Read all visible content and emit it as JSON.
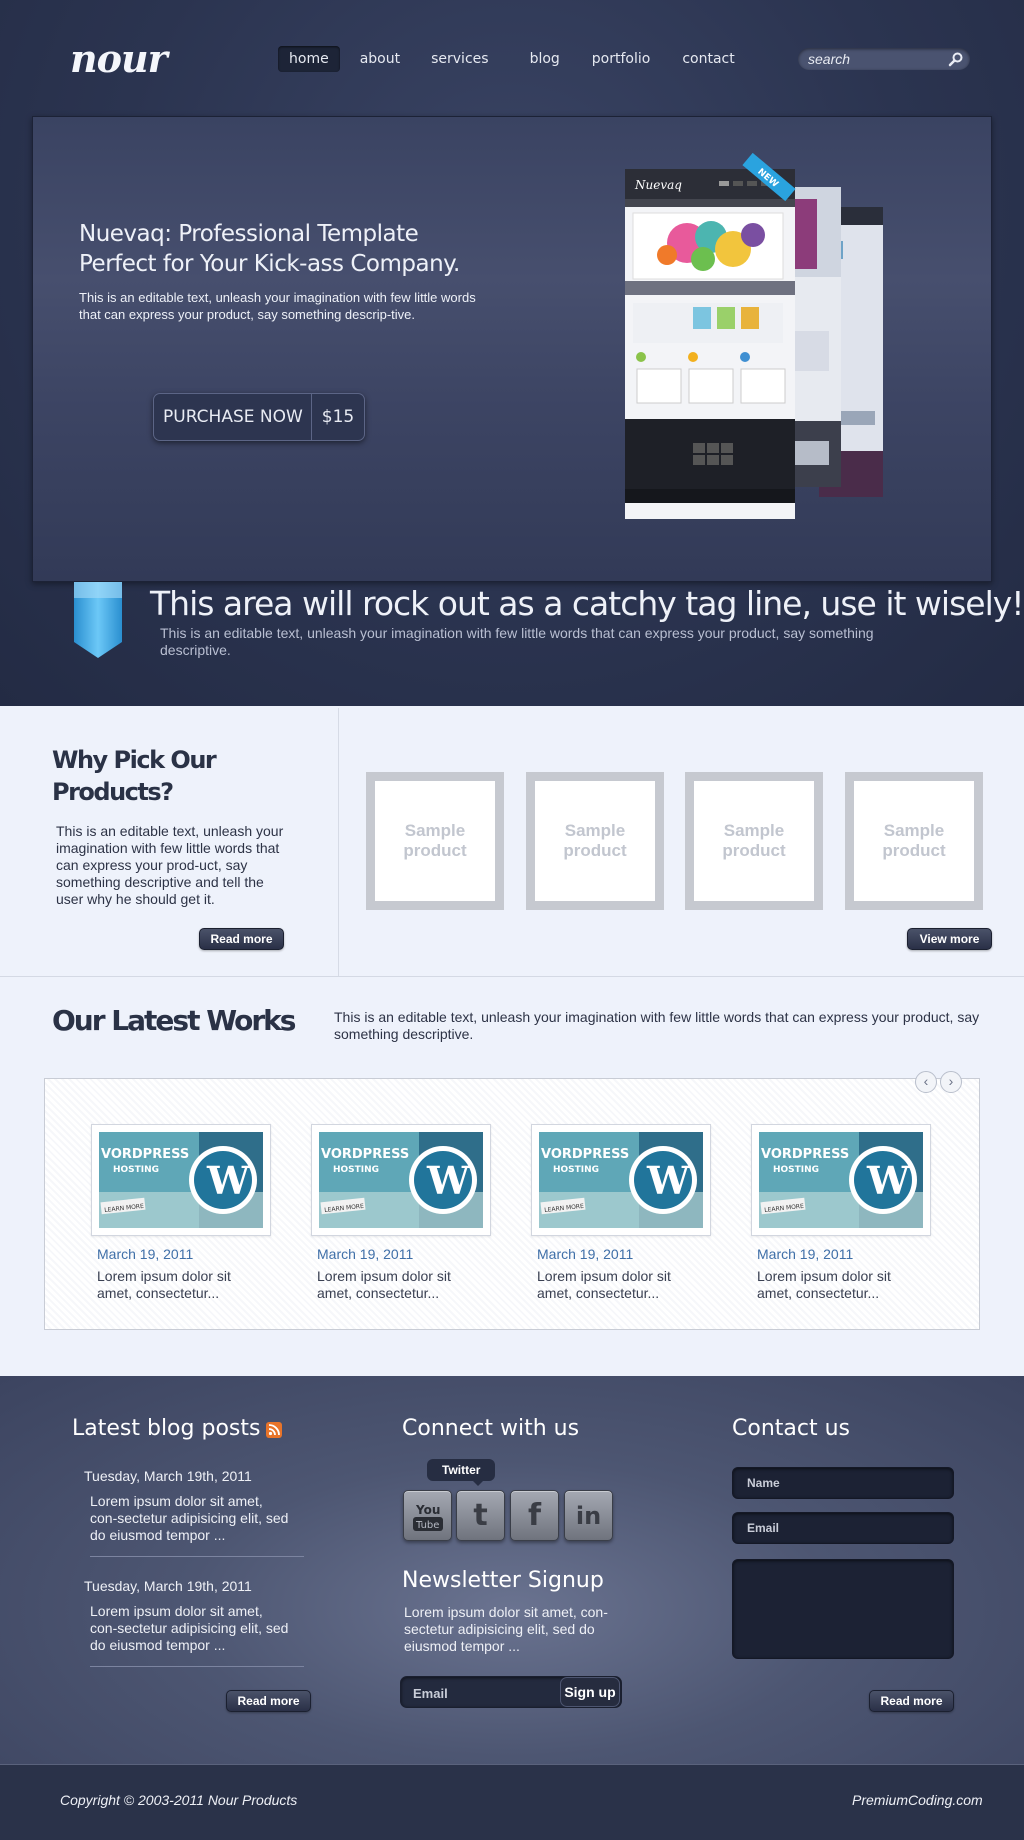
{
  "header": {
    "logo": "nour",
    "nav": [
      "home",
      "about",
      "services",
      "blog",
      "portfolio",
      "contact"
    ],
    "active_nav": "home",
    "search_placeholder": "search"
  },
  "hero": {
    "title": "Nuevaq: Professional Template Perfect for Your Kick-ass Company.",
    "text": "This is an editable text, unleash your imagination with few little words that can express your product, say something descrip-tive.",
    "purchase_label": "PURCHASE NOW",
    "price": "$15",
    "mockup_brand": "Nuevaq",
    "mockup_badge": "NEW"
  },
  "tagline": {
    "title": "This area will rock out as a catchy tag line, use it wisely!",
    "text": "This is an editable text, unleash your imagination with few little words that can express your product, say something descriptive."
  },
  "why": {
    "title": "Why Pick Our Products?",
    "text": "This is an editable text, unleash your imagination with few little words that can express your prod-uct, say something descriptive and tell the user why he should get it.",
    "read_more": "Read more",
    "products": [
      "Sample product",
      "Sample product",
      "Sample product",
      "Sample product"
    ],
    "view_more": "View more"
  },
  "works": {
    "title": "Our Latest Works",
    "text": "This is an editable text, unleash your imagination with few little words that can express your product, say something descriptive.",
    "items": [
      {
        "date": "March 19, 2011",
        "desc": "Lorem ipsum dolor sit amet, consectetur...",
        "thumb_title": "VORDPRESS",
        "thumb_sub": "HOSTING",
        "thumb_btn": "LEARN MORE"
      },
      {
        "date": "March 19, 2011",
        "desc": "Lorem ipsum dolor sit amet, consectetur...",
        "thumb_title": "VORDPRESS",
        "thumb_sub": "HOSTING",
        "thumb_btn": "LEARN MORE"
      },
      {
        "date": "March 19, 2011",
        "desc": "Lorem ipsum dolor sit amet, consectetur...",
        "thumb_title": "VORDPRESS",
        "thumb_sub": "HOSTING",
        "thumb_btn": "LEARN MORE"
      },
      {
        "date": "March 19, 2011",
        "desc": "Lorem ipsum dolor sit amet, consectetur...",
        "thumb_title": "VORDPRESS",
        "thumb_sub": "HOSTING",
        "thumb_btn": "LEARN MORE"
      }
    ],
    "prev_symbol": "‹",
    "next_symbol": "›"
  },
  "footer": {
    "blog": {
      "title": "Latest blog posts",
      "posts": [
        {
          "date": "Tuesday, March 19th, 2011",
          "text": "Lorem ipsum dolor sit amet, con-sectetur adipisicing elit, sed do eiusmod tempor ..."
        },
        {
          "date": "Tuesday, March 19th, 2011",
          "text": "Lorem ipsum dolor sit amet, con-sectetur adipisicing elit, sed do eiusmod tempor ..."
        }
      ],
      "read_more": "Read more"
    },
    "connect": {
      "title": "Connect with us",
      "tooltip": "Twitter",
      "networks": [
        "youtube-icon",
        "twitter-icon",
        "facebook-icon",
        "linkedin-icon"
      ],
      "youtube_you": "You",
      "youtube_tube": "Tube",
      "twitter_glyph": "t",
      "facebook_glyph": "f",
      "linkedin_glyph": "in"
    },
    "newsletter": {
      "title": "Newsletter Signup",
      "text": "Lorem ipsum dolor sit amet, con-sectetur adipisicing elit, sed do eiusmod tempor ...",
      "email_placeholder": "Email",
      "signup_label": "Sign up"
    },
    "contact": {
      "title": "Contact us",
      "name_placeholder": "Name",
      "email_placeholder": "Email",
      "read_more": "Read more"
    },
    "copyright": "Copyright © 2003-2011 Nour Products",
    "credit": "PremiumCoding.com"
  },
  "colors": {
    "header_bg": "#2b3450",
    "accent_blue": "#3f6fa8",
    "ribbon_blue": "#3da7e6",
    "rss_orange": "#e8742a"
  }
}
